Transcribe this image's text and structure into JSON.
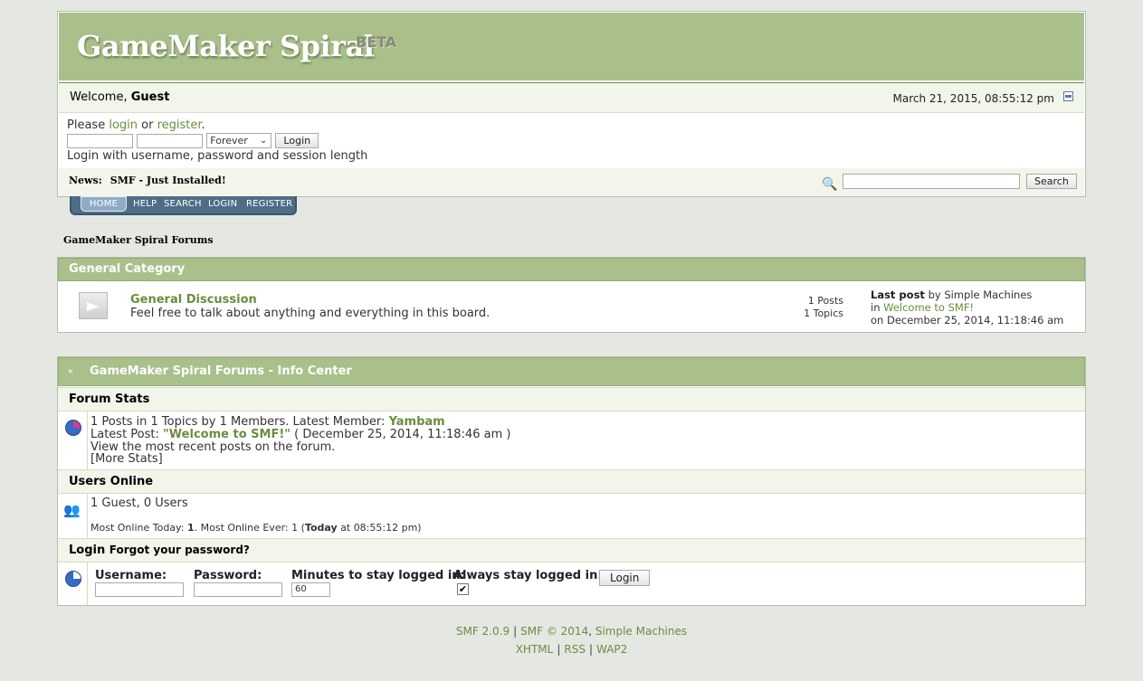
{
  "header": {
    "forum_title": "GameMaker Spiral",
    "beta": "BETA",
    "welcome_prefix": "Welcome, ",
    "welcome_user": "Guest",
    "date": "March 21, 2015, 08:55:12 pm",
    "login_prompt_1": "Please ",
    "login_link": "login",
    "login_prompt_2": " or ",
    "register_link": "register",
    "login_prompt_3": ".",
    "session_option": "Forever",
    "login_button": "Login",
    "login_hint": "Login with username, password and session length",
    "news_label": "News:",
    "news_text": "SMF - Just Installed!",
    "search_button": "Search"
  },
  "menu": {
    "items": [
      "HOME",
      "HELP",
      "SEARCH",
      "LOGIN",
      "REGISTER"
    ]
  },
  "breadcrumb": "GameMaker Spiral Forums",
  "category": {
    "title": "General Category",
    "board_name": "General Discussion",
    "board_desc": "Feel free to talk about anything and everything in this board.",
    "posts": "1 Posts",
    "topics": "1 Topics",
    "last_post_label": "Last post",
    "last_post_by": " by Simple Machines",
    "last_post_in": "in ",
    "last_post_topic": "Welcome to SMF!",
    "last_post_on": "on December 25, 2014, 11:18:46 am"
  },
  "info": {
    "title": "GameMaker Spiral Forums - Info Center",
    "toggle": "*",
    "stats_heading": "Forum Stats",
    "stats_line": "1 Posts in 1 Topics by 1 Members. Latest Member: ",
    "latest_member": "Yambam",
    "latest_post_label": "Latest Post: ",
    "latest_post_title": "\"Welcome to SMF!\"",
    "latest_post_date": " ( December 25, 2014, 11:18:46 am )",
    "recent_link": "View the most recent posts on the forum.",
    "more_stats": "[More Stats]",
    "online_heading": "Users Online",
    "online_count": "1 Guest, 0 Users",
    "most_online_1": "Most Online Today: ",
    "most_online_today": "1",
    "most_online_2": ". Most Online Ever: 1 (",
    "most_online_today_word": "Today",
    "most_online_3": " at 08:55:12 pm)",
    "login_heading": "Login",
    "forgot_link": "Forgot your password?",
    "username_label": "Username:",
    "password_label": "Password:",
    "minutes_label": "Minutes to stay logged in:",
    "minutes_value": "60",
    "always_label": "Always stay logged in:",
    "checkmark": "✔",
    "login_button": "Login"
  },
  "footer": {
    "smf_version": "SMF 2.0.9",
    "smf_copyright": "SMF © 2014",
    "simple_machines": "Simple Machines",
    "xhtml": "XHTML",
    "rss": "RSS",
    "wap2": "WAP2",
    "separator": "|"
  },
  "colors": {
    "accent": "#a9c08a",
    "link": "#6b8d3f",
    "menu": "#4f6d86"
  }
}
